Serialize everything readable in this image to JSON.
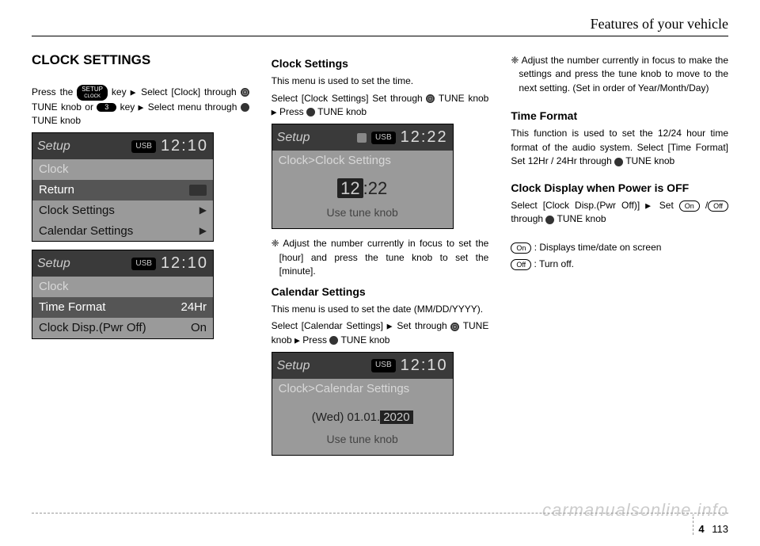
{
  "header": {
    "title": "Features of your vehicle"
  },
  "col1": {
    "h1": "CLOCK SETTINGS",
    "intro_a": "Press the ",
    "setup_key_top": "SETUP",
    "setup_key_bot": "CLOCK",
    "intro_b": " key ",
    "intro_c": "Select [Clock] through ",
    "intro_d": " TUNE knob or ",
    "key3": "3",
    "intro_e": " key ",
    "intro_f": "Select menu through ",
    "intro_g": " TUNE knob",
    "screen1": {
      "setup": "Setup",
      "usb": "USB",
      "time": "12:10",
      "title": "Clock",
      "rows": [
        "Return",
        "Clock Settings",
        "Calendar Settings"
      ]
    },
    "screen2": {
      "setup": "Setup",
      "usb": "USB",
      "time": "12:10",
      "title": "Clock",
      "rowA": "Time Format",
      "rowA_val": "24Hr",
      "rowB": "Clock Disp.(Pwr Off)",
      "rowB_val": "On"
    }
  },
  "col2": {
    "h2a": "Clock Settings",
    "p1": "This menu is used to set the time.",
    "p2a": "Select [Clock Settings] Set through ",
    "p2b": " TUNE knob ",
    "p2c": "Press ",
    "p2d": " TUNE knob",
    "screen3": {
      "setup": "Setup",
      "usb": "USB",
      "time": "12:22",
      "crumb": "Clock>Clock Settings",
      "big_hr": "12",
      "big_mn": ":22",
      "hint": "Use tune knob"
    },
    "note1": "❈ Adjust the number currently in focus to set the [hour] and press the tune knob to set the [minute].",
    "h2b": "Calendar Settings",
    "p3": "This menu is used to set the date (MM/DD/YYYY).",
    "p4a": "Select [Calendar Settings] ",
    "p4b": "Set through ",
    "p4c": " TUNE knob ",
    "p4d": "Press ",
    "p4e": " TUNE knob",
    "screen4": {
      "setup": "Setup",
      "usb": "USB",
      "time": "12:10",
      "crumb": "Clock>Calendar Settings",
      "dow": "(Wed)",
      "date_a": "01.01.",
      "date_b": "2020",
      "hint": "Use tune knob"
    }
  },
  "col3": {
    "note2": "❈ Adjust the number currently in focus to make the settings and press the tune knob to move to the next setting. (Set in order of Year/Month/Day)",
    "h2c": "Time Format",
    "p5": "This function is used to set the 12/24 hour time format of the audio system. Select [Time Format] Set 12Hr / 24Hr through ",
    "p5b": " TUNE knob",
    "h2d": "Clock Display when Power is OFF",
    "p6a": "Select [Clock Disp.(Pwr Off)] ",
    "p6b": "Set ",
    "on": "On",
    "off": "Off",
    "p6c": " through ",
    "p6d": " TUNE knob",
    "legend_on": " : Displays time/date on screen",
    "legend_off": " : Turn off."
  },
  "footer": {
    "chapter": "4",
    "page": "113"
  },
  "watermark": "carmanualsonline.info"
}
